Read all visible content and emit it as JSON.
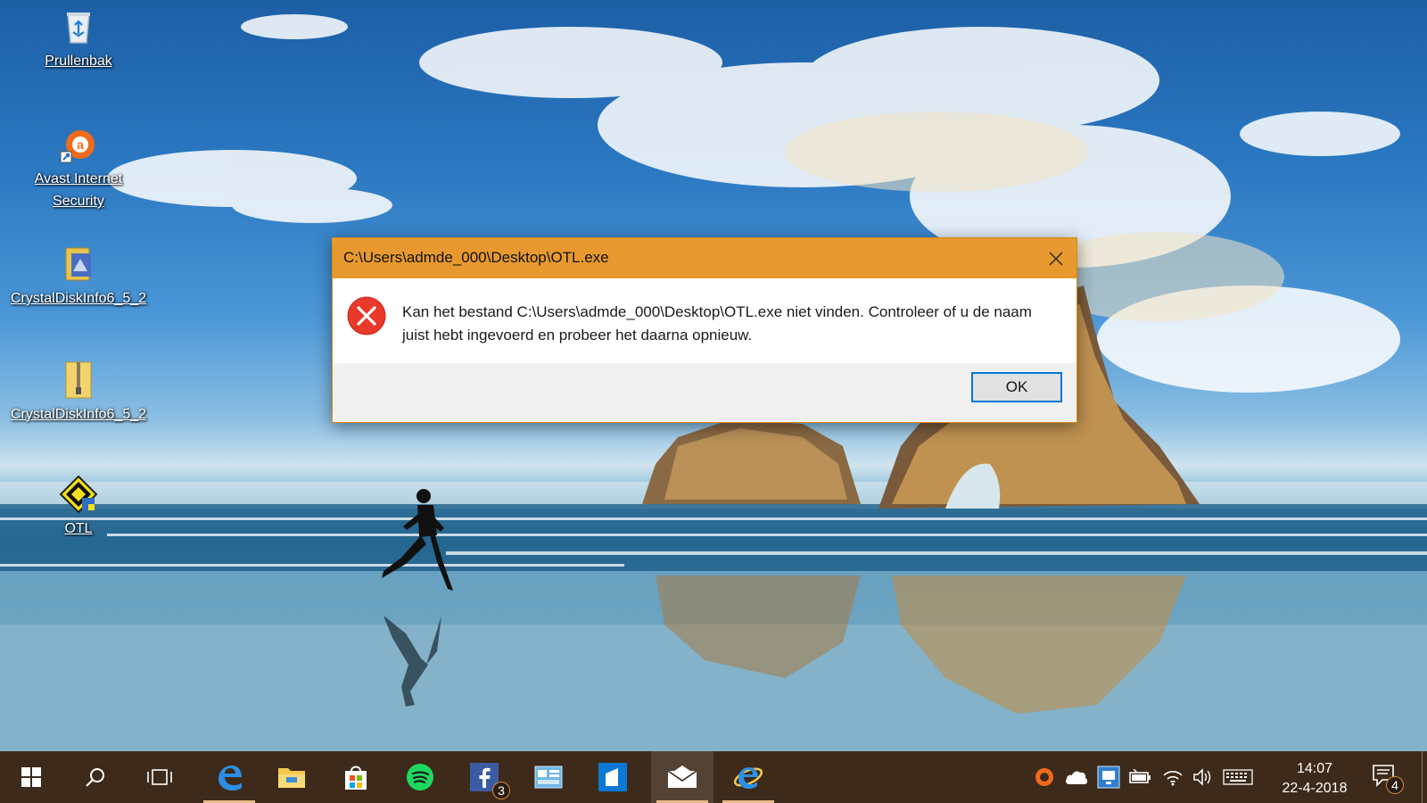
{
  "desktop": {
    "icons": [
      {
        "name": "recycle-bin",
        "label": "Prullenbak"
      },
      {
        "name": "avast",
        "label": "Avast Internet Security"
      },
      {
        "name": "crystaldiskinfo-app",
        "label": "CrystalDiskInfo6_5_2"
      },
      {
        "name": "crystaldiskinfo-zip",
        "label": "CrystalDiskInfo6_5_2"
      },
      {
        "name": "otl",
        "label": "OTL"
      }
    ]
  },
  "dialog": {
    "title": "C:\\Users\\admde_000\\Desktop\\OTL.exe",
    "message": "Kan het bestand C:\\Users\\admde_000\\Desktop\\OTL.exe niet vinden. Controleer of u de naam juist hebt ingevoerd en probeer het daarna opnieuw.",
    "ok_label": "OK",
    "title_color": "#e7992f",
    "error_icon": "error-x-icon"
  },
  "taskbar": {
    "apps": [
      "start",
      "search",
      "task-view",
      "edge",
      "file-explorer",
      "store",
      "spotify",
      "facebook",
      "control-panel",
      "sticky-app",
      "mail",
      "internet-explorer"
    ],
    "facebook_badge": "3",
    "tray_icons": [
      "avast-tray-icon",
      "onedrive-icon",
      "network-app-icon",
      "battery-icon",
      "wifi-icon",
      "volume-icon",
      "keyboard-icon"
    ],
    "time": "14:07",
    "date": "22-4-2018",
    "notification_badge": "4",
    "color": "#3d2a1a"
  }
}
